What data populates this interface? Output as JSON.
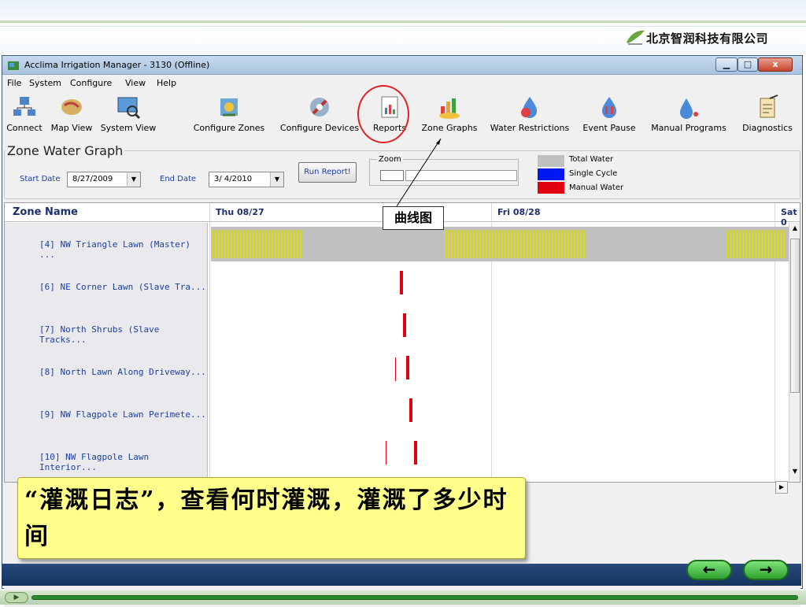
{
  "slide": {
    "company": "北京智润科技有限公司"
  },
  "window": {
    "title": "Acclima Irrigation Manager - 3130 (Offline)",
    "min": "▁",
    "max": "□",
    "close": "x"
  },
  "menu": [
    "File",
    "System",
    "Configure",
    "View",
    "Help"
  ],
  "toolbar": [
    {
      "label": "Connect",
      "icon": "connect-icon"
    },
    {
      "label": "Map View",
      "icon": "map-icon"
    },
    {
      "label": "System View",
      "icon": "system-view-icon"
    },
    {
      "label": "Configure Zones",
      "icon": "configure-zones-icon"
    },
    {
      "label": "Configure Devices",
      "icon": "configure-devices-icon"
    },
    {
      "label": "Reports",
      "icon": "reports-icon"
    },
    {
      "label": "Zone Graphs",
      "icon": "zone-graphs-icon"
    },
    {
      "label": "Water Restrictions",
      "icon": "water-restrictions-icon"
    },
    {
      "label": "Event Pause",
      "icon": "event-pause-icon"
    },
    {
      "label": "Manual Programs",
      "icon": "manual-programs-icon"
    },
    {
      "label": "Diagnostics",
      "icon": "diagnostics-icon"
    }
  ],
  "panel": {
    "title": "Zone Water Graph",
    "start_label": "Start Date",
    "start_value": "8/27/2009",
    "end_label": "End Date",
    "end_value": "3/ 4/2010",
    "run_button": "Run Report!",
    "zoom_label": "Zoom",
    "legend": [
      {
        "label": "Total Water",
        "color": "#c0c0c0"
      },
      {
        "label": "Single Cycle",
        "color": "#0018f0"
      },
      {
        "label": "Manual Water",
        "color": "#e00010"
      }
    ]
  },
  "grid": {
    "zone_header": "Zone Name",
    "days": [
      "Thu 08/27",
      "Fri 08/28",
      "Sat 0"
    ],
    "zones": [
      "[4]  NW Triangle Lawn (Master) ...",
      "[6]  NE Corner Lawn (Slave Tra...",
      "[7]  North Shrubs (Slave Tracks...",
      "[8]  North Lawn Along Driveway...",
      "[9]  NW Flagpole Lawn Perimete...",
      "[10]  NW Flagpole Lawn Interior..."
    ]
  },
  "annotation": {
    "callout": "曲线图",
    "note": "“灌溉日志”，查看何时灌溉，灌溉了多少时间"
  },
  "nav": {
    "back": "←",
    "next": "→",
    "play": "▶"
  }
}
